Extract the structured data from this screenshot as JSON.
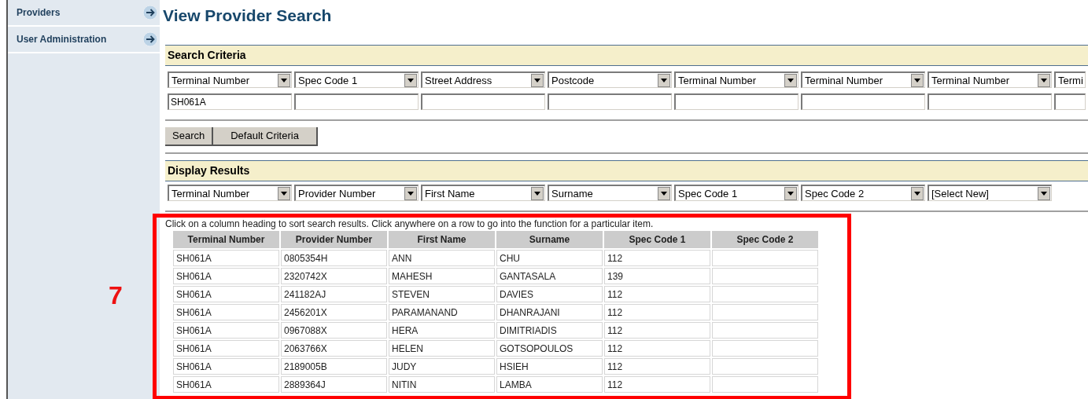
{
  "sidebar": {
    "items": [
      {
        "label": "Providers"
      },
      {
        "label": "User Administration"
      }
    ]
  },
  "title": "View Provider Search",
  "search_criteria": {
    "heading": "Search Criteria",
    "fields": [
      {
        "field": "Terminal Number",
        "value": "SH061A"
      },
      {
        "field": "Spec Code 1"
      },
      {
        "field": "Street Address"
      },
      {
        "field": "Postcode"
      },
      {
        "field": "Terminal Number"
      },
      {
        "field": "Terminal Number"
      },
      {
        "field": "Terminal Number"
      },
      {
        "field": "Termi"
      }
    ],
    "buttons": [
      "Search",
      "Default Criteria"
    ]
  },
  "display_results": {
    "heading": "Display Results",
    "columns": [
      "Terminal Number",
      "Provider Number",
      "First Name",
      "Surname",
      "Spec Code 1",
      "Spec Code 2",
      "[Select New]"
    ]
  },
  "instructions": "Click on a column heading to sort search results. Click anywhere on a row to go into the function for a particular item.",
  "table": {
    "columns": [
      "Terminal Number",
      "Provider Number",
      "First Name",
      "Surname",
      "Spec Code 1",
      "Spec Code 2"
    ],
    "rows": [
      [
        "SH061A",
        "0805354H",
        "ANN",
        "CHU",
        "112"
      ],
      [
        "SH061A",
        "2320742X",
        "MAHESH",
        "GANTASALA",
        "139"
      ],
      [
        "SH061A",
        "241182AJ",
        "STEVEN",
        "DAVIES",
        "112"
      ],
      [
        "SH061A",
        "2456201X",
        "PARAMANAND",
        "DHANRAJANI",
        "112"
      ],
      [
        "SH061A",
        "0967088X",
        "HERA",
        "DIMITRIADIS",
        "112"
      ],
      [
        "SH061A",
        "2063766X",
        "HELEN",
        "GOTSOPOULOS",
        "112"
      ],
      [
        "SH061A",
        "2189005B",
        "JUDY",
        "HSIEH",
        "112"
      ],
      [
        "SH061A",
        "2889364J",
        "NITIN",
        "LAMBA",
        "112"
      ]
    ]
  },
  "annotation": {
    "label": "7"
  }
}
